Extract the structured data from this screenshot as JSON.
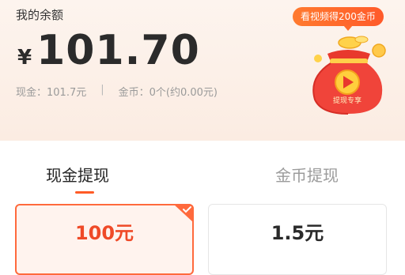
{
  "balance": {
    "label": "我的余额",
    "currency": "¥",
    "amount": "101.70",
    "cash_text": "现金：101.7元",
    "separator": "|",
    "coin_text": "金币：0个(约0.00元)"
  },
  "promo": {
    "badge_text": "看视频得200金币",
    "play_label": "提现专享"
  },
  "tabs": [
    {
      "label": "现金提现",
      "active": true
    },
    {
      "label": "金币提现",
      "active": false
    }
  ],
  "options": [
    {
      "label": "100元",
      "selected": true
    },
    {
      "label": "1.5元",
      "selected": false
    }
  ],
  "colors": {
    "accent": "#ff5b26",
    "selected_text": "#ef4a28",
    "header_bg": "#fdf4ee"
  },
  "icons": {
    "bag": "red-envelope-bag-icon",
    "play": "play-icon",
    "check": "check-icon"
  }
}
